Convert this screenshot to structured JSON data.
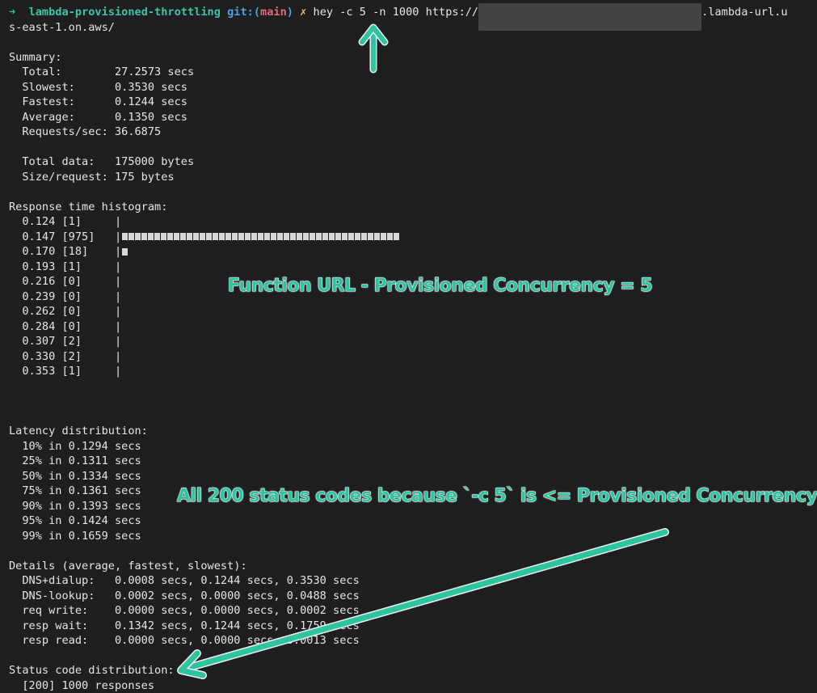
{
  "prompt": {
    "arrow": "➜",
    "repo": "lambda-provisioned-throttling",
    "git_label": "git:(",
    "branch": "main",
    "git_close": ")",
    "dirty": "✗",
    "command": "hey -c 5 -n 1000 https://",
    "url_suffix": ".lambda-url.u",
    "url_line2": "s-east-1.on.aws/"
  },
  "summary": {
    "header": "Summary:",
    "total": "  Total:        27.2573 secs",
    "slowest": "  Slowest:      0.3530 secs",
    "fastest": "  Fastest:      0.1244 secs",
    "average": "  Average:      0.1350 secs",
    "rps": "  Requests/sec: 36.6875",
    "total_data": "  Total data:   175000 bytes",
    "size_request": "  Size/request: 175 bytes"
  },
  "histogram": {
    "header": "Response time histogram:",
    "rows": [
      {
        "label": "  0.124 [1]     |",
        "fraction": 0
      },
      {
        "label": "  0.147 [975]   |",
        "fraction": 1
      },
      {
        "label": "  0.170 [18]    |",
        "fraction": 0.0185
      },
      {
        "label": "  0.193 [1]     |",
        "fraction": 0
      },
      {
        "label": "  0.216 [0]     |",
        "fraction": 0
      },
      {
        "label": "  0.239 [0]     |",
        "fraction": 0
      },
      {
        "label": "  0.262 [0]     |",
        "fraction": 0
      },
      {
        "label": "  0.284 [0]     |",
        "fraction": 0
      },
      {
        "label": "  0.307 [2]     |",
        "fraction": 0
      },
      {
        "label": "  0.330 [2]     |",
        "fraction": 0
      },
      {
        "label": "  0.353 [1]     |",
        "fraction": 0
      }
    ]
  },
  "latency": {
    "header": "Latency distribution:",
    "rows": [
      "  10% in 0.1294 secs",
      "  25% in 0.1311 secs",
      "  50% in 0.1334 secs",
      "  75% in 0.1361 secs",
      "  90% in 0.1393 secs",
      "  95% in 0.1424 secs",
      "  99% in 0.1659 secs"
    ]
  },
  "details": {
    "header": "Details (average, fastest, slowest):",
    "rows": [
      "  DNS+dialup:   0.0008 secs, 0.1244 secs, 0.3530 secs",
      "  DNS-lookup:   0.0002 secs, 0.0000 secs, 0.0488 secs",
      "  req write:    0.0000 secs, 0.0000 secs, 0.0002 secs",
      "  resp wait:    0.1342 secs, 0.1244 secs, 0.1759 secs",
      "  resp read:    0.0000 secs, 0.0000 secs, 0.0013 secs"
    ]
  },
  "status": {
    "header": "Status code distribution:",
    "row": "  [200] 1000 responses"
  },
  "annotations": {
    "title": "Function URL - Provisioned Concurrency = 5",
    "note": "All 200 status codes because `-c 5` is <= Provisioned Concurrency"
  },
  "colors": {
    "background": "#1e1e1e",
    "accent": "#2dc4a0",
    "branch": "#e06c75"
  }
}
